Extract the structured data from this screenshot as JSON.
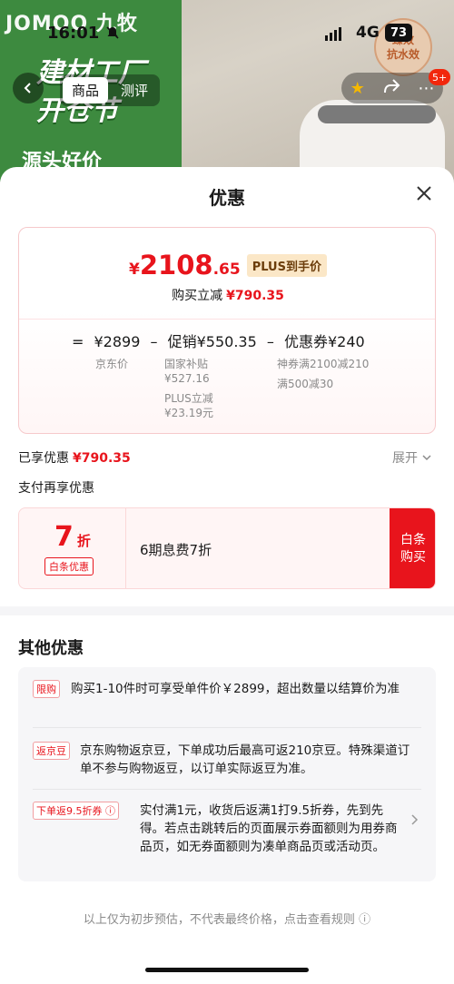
{
  "background": {
    "brand": "JOMOO 九牧",
    "slogan_lines": [
      "建材工厂",
      "开仓节"
    ],
    "slogan_sub": "源头好价",
    "stamp": "臻效\n抗水效"
  },
  "status_bar": {
    "time": "16:01",
    "network": "4G",
    "battery": "73"
  },
  "nav": {
    "tabs": [
      {
        "label": "商品"
      },
      {
        "label": "测评"
      }
    ],
    "badge": "5+"
  },
  "sheet": {
    "title": "优惠",
    "price": {
      "currency": "¥",
      "integer": "2108",
      "decimal": ".65",
      "tag": "PLUS到手价"
    },
    "instant_reduce": {
      "label": "购买立减",
      "value": "¥790.35"
    },
    "formula": {
      "equals": "=",
      "base": "¥2899",
      "minus1": "–",
      "promo": "促销¥550.35",
      "minus2": "–",
      "coupon": "优惠券¥240"
    },
    "labels": {
      "base_label": "京东价",
      "promo_1_name": "国家补贴",
      "promo_1_value": "¥527.16",
      "promo_2_name": "PLUS立减",
      "promo_2_value": "¥23.19元",
      "coupon_1": "神券满2100减210",
      "coupon_2": "满500减30"
    },
    "enjoyed": {
      "label": "已享优惠",
      "value": "¥790.35"
    },
    "expand_label": "展开",
    "pay_title": "支付再享优惠",
    "baitiao": {
      "discount_num": "7",
      "discount_unit": "折",
      "tag": "白条优惠",
      "text": "6期息费7折",
      "button": "白条\n购买"
    },
    "other": {
      "title": "其他优惠",
      "items": [
        {
          "tag": "限购",
          "text": "购买1-10件时可享受单件价￥2899，超出数量以结算价为准"
        },
        {
          "tag": "返京豆",
          "text": "京东购物返京豆，下单成功后最高可返210京豆。特殊渠道订单不参与购物返豆，以订单实际返豆为准。"
        },
        {
          "tag": "下单返9.5折券",
          "text": "实付满1元，收货后返满1打9.5折券，先到先得。若点击跳转后的页面展示券面额则为用券商品页，如无券面额则为凑单商品页或活动页。"
        }
      ]
    },
    "footer_note": "以上仅为初步预估，不代表最终价格，点击查看规则"
  }
}
